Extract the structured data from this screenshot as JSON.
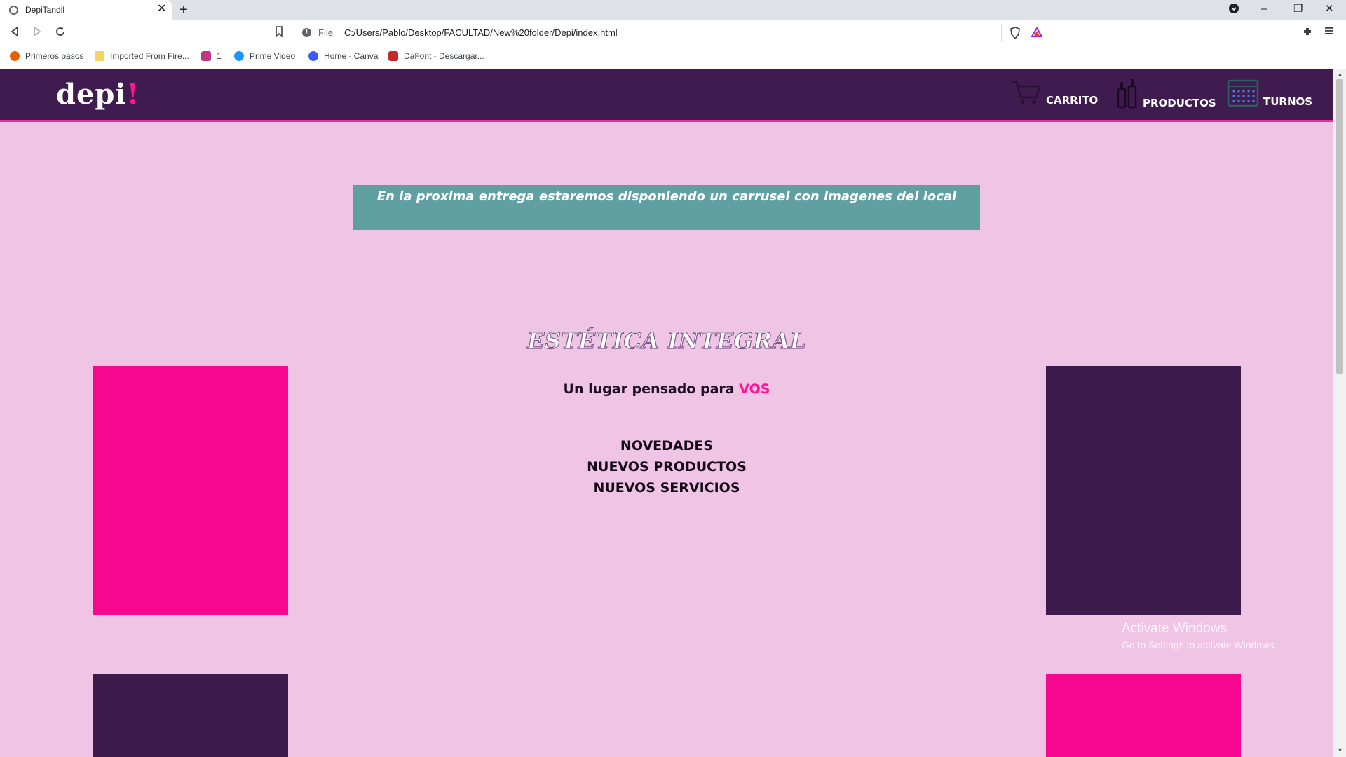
{
  "browser": {
    "tab_title": "DepiTandil",
    "tab_close": "✕",
    "new_tab": "+",
    "window_controls": {
      "minimize": "–",
      "restore": "❐",
      "close": "✕"
    },
    "url_scheme": "File",
    "url": "C:/Users/Pablo/Desktop/FACULTAD/New%20folder/Depi/index.html",
    "bookmarks": [
      {
        "label": "Primeros pasos",
        "icon": "firefox-icon",
        "color": "#e66000"
      },
      {
        "label": "Imported From Fire...",
        "icon": "folder-icon",
        "color": "#f6d365"
      },
      {
        "label": "1",
        "icon": "instagram-icon",
        "color": "#c13584"
      },
      {
        "label": "Prime Video",
        "icon": "prime-video-icon",
        "color": "#1a98ff"
      },
      {
        "label": "Home - Canva",
        "icon": "canva-icon",
        "color": "#3d5afe"
      },
      {
        "label": "DaFont - Descargar...",
        "icon": "dafont-icon",
        "color": "#c62828"
      }
    ]
  },
  "site": {
    "logo_text": "depi",
    "logo_bang": "!",
    "nav": [
      {
        "label": "CARRITO",
        "icon": "cart-icon"
      },
      {
        "label": "PRODUCTOS",
        "icon": "products-bottles-icon"
      },
      {
        "label": "TURNOS",
        "icon": "calendar-icon"
      }
    ],
    "banner_text": "En la proxima entrega estaremos disponiendo un carrusel con imagenes del local",
    "hero_title": "ESTÉTICA INTEGRAL",
    "tagline": "Un lugar pensado para",
    "tagline_accent": "VOS",
    "menu_links": [
      "NOVEDADES",
      "NUEVOS PRODUCTOS",
      "NUEVOS SERVICIOS"
    ]
  },
  "colors": {
    "page_bg": "#f0c4e4",
    "header_bg": "#3f1b50",
    "accent_pink": "#f5088f",
    "dark_purple": "#3e1b4d",
    "banner_bg": "#60a0a3"
  },
  "os_watermark": {
    "title": "Activate Windows",
    "subtitle": "Go to Settings to activate Windows."
  }
}
